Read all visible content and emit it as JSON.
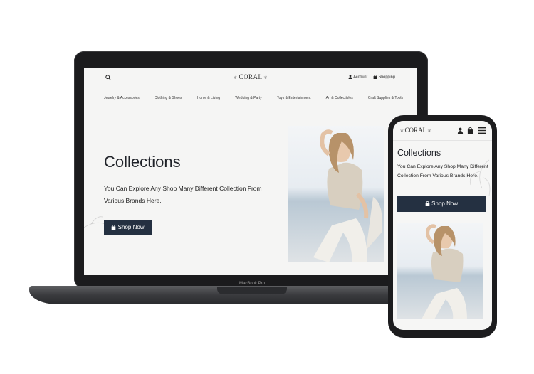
{
  "laptop": {
    "label": "MacBook Pro"
  },
  "desktop_site": {
    "logo": "CORAL",
    "header": {
      "account_label": "Account",
      "shopping_label": "Shopping"
    },
    "nav": [
      "Jewelry & Accessories",
      "Clothing & Shoes",
      "Home & Living",
      "Wedding & Party",
      "Toys & Entertainment",
      "Art & Collectibles",
      "Craft Supplies & Tools"
    ],
    "hero": {
      "title": "Collections",
      "description": "You Can Explore Any Shop Many Different Collection From Various Brands Here.",
      "button_label": "Shop Now"
    }
  },
  "mobile_site": {
    "logo": "CORAL",
    "hero": {
      "title": "Collections",
      "description": "You Can Explore Any Shop Many Different Collection From Various Brands Here.",
      "button_label": "Shop Now"
    }
  },
  "colors": {
    "button_bg": "#243041",
    "page_bg": "#f5f5f4",
    "device_frame": "#1c1c1e"
  },
  "icons": [
    "search-icon",
    "account-icon",
    "bag-icon",
    "menu-icon",
    "floral-ornament-icon"
  ]
}
